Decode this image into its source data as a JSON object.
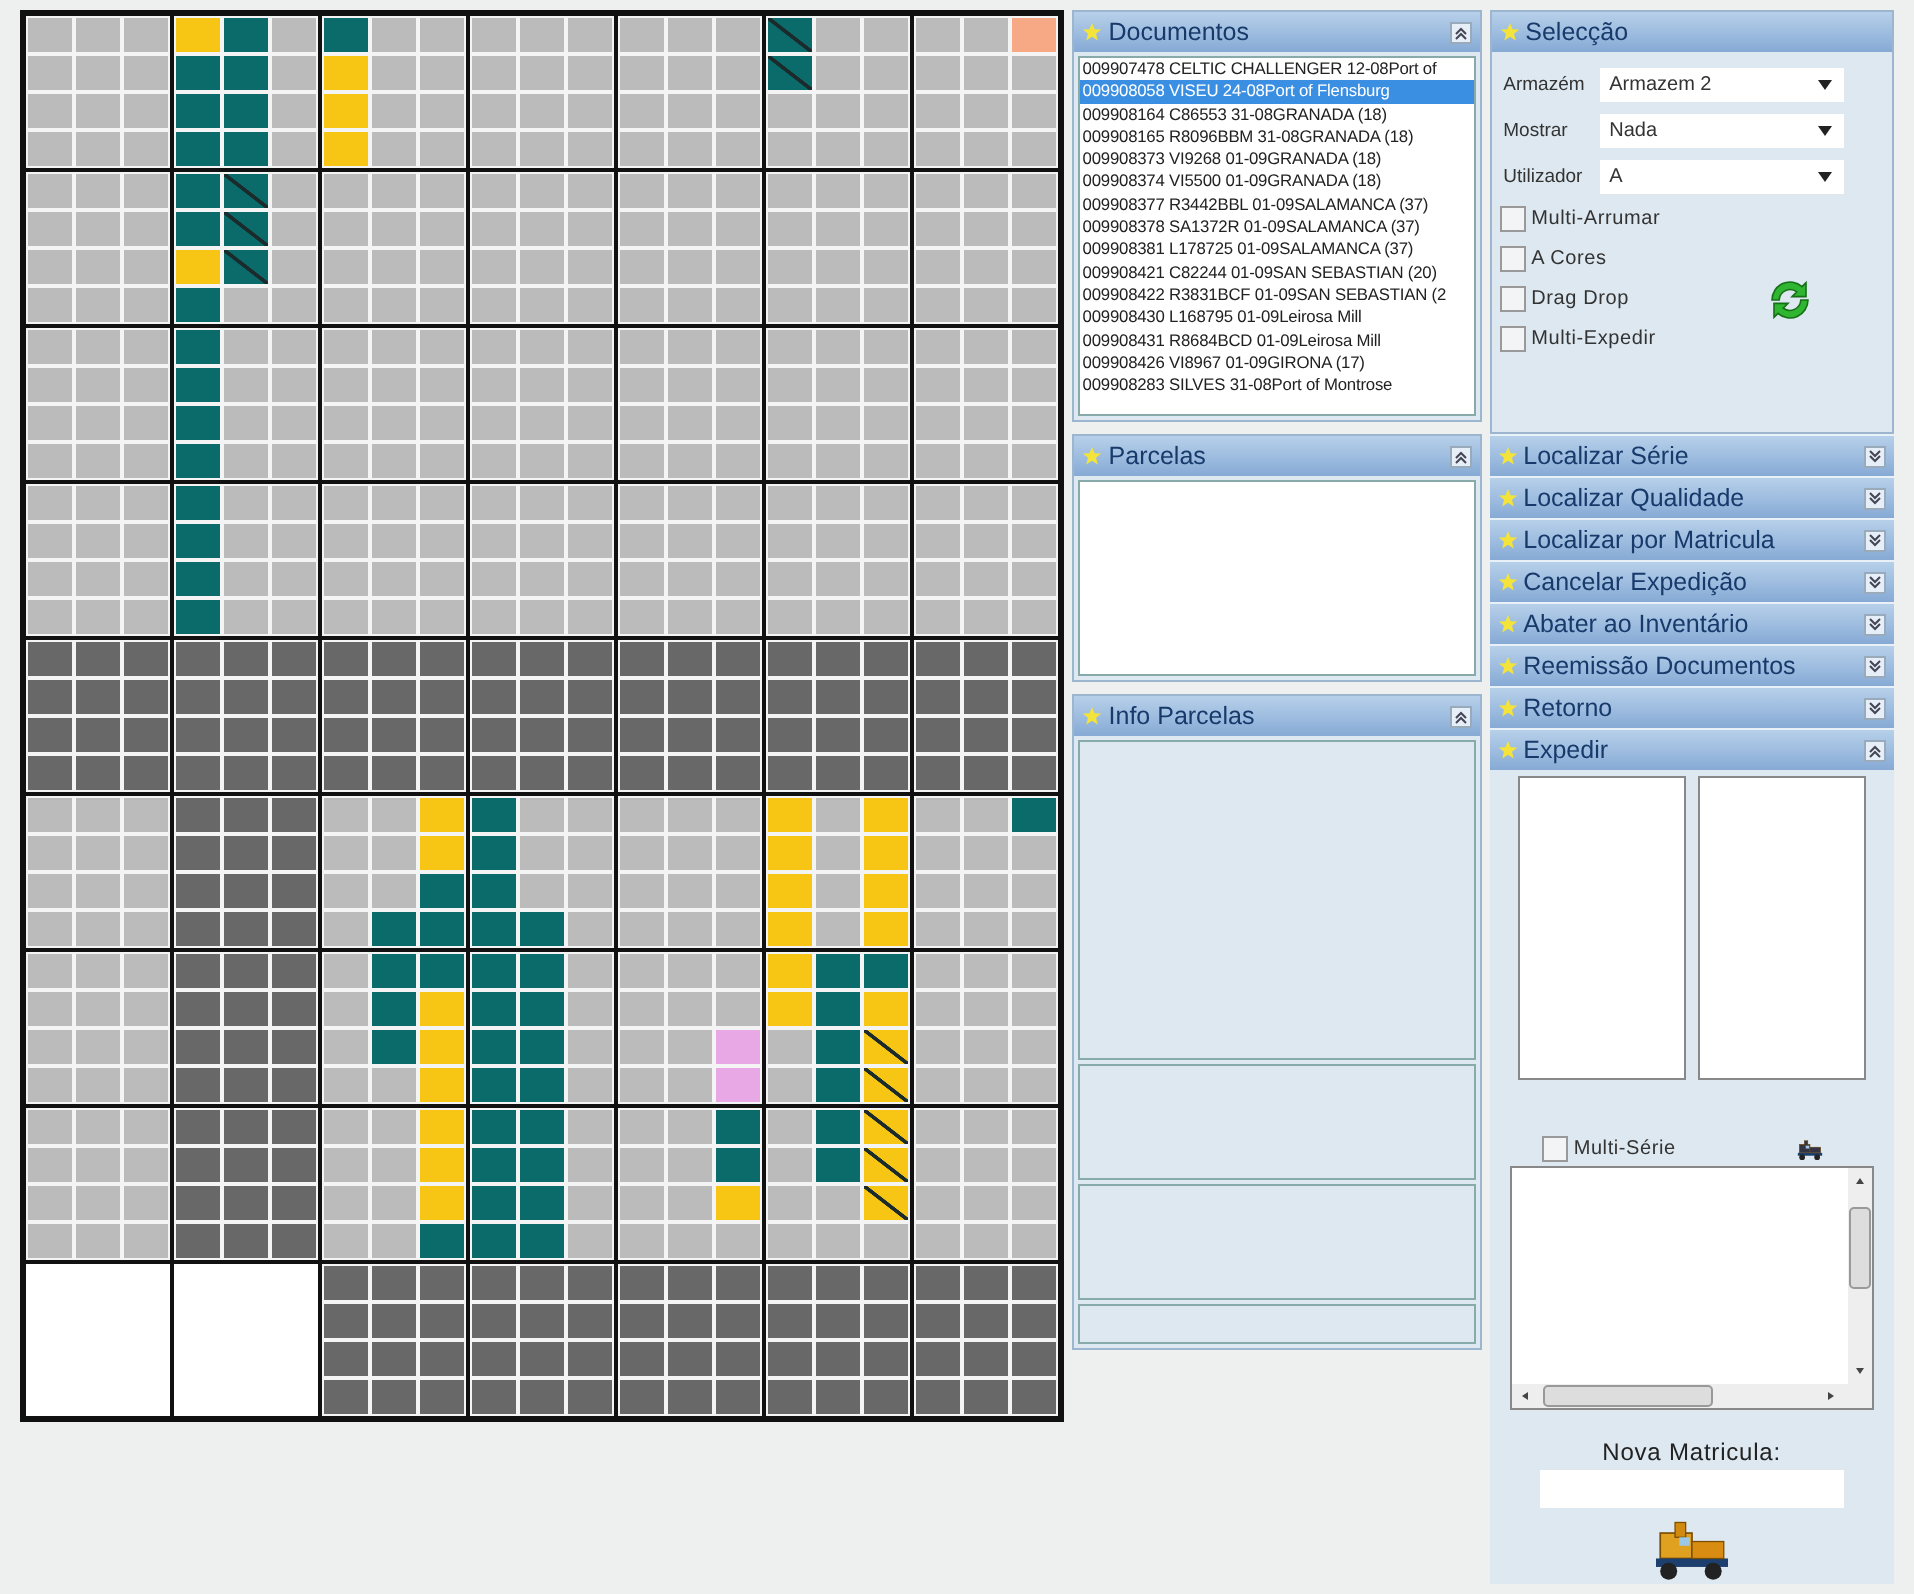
{
  "storage_map": {
    "block_rows": [
      {
        "blocks": [
          {
            "kind": "free"
          },
          {
            "kind": "mixed",
            "rows": [
              [
                {
                  "kind": "reserved"
                },
                {
                  "kind": "stock"
                },
                {
                  "kind": "free"
                }
              ],
              [
                {
                  "kind": "stock"
                },
                {
                  "kind": "stock"
                },
                {
                  "kind": "free"
                }
              ],
              [
                {
                  "kind": "stock"
                },
                {
                  "kind": "stock"
                },
                {
                  "kind": "free"
                }
              ],
              [
                {
                  "kind": "stock"
                },
                {
                  "kind": "stock"
                },
                {
                  "kind": "free"
                }
              ]
            ]
          },
          {
            "kind": "mixed",
            "rows": [
              [
                {
                  "kind": "stock"
                },
                {
                  "kind": "free"
                },
                {
                  "kind": "free"
                }
              ],
              [
                {
                  "kind": "reserved"
                },
                {
                  "kind": "free"
                },
                {
                  "kind": "free"
                }
              ],
              [
                {
                  "kind": "reserved"
                },
                {
                  "kind": "free"
                },
                {
                  "kind": "free"
                }
              ],
              [
                {
                  "kind": "reserved"
                },
                {
                  "kind": "free"
                },
                {
                  "kind": "free"
                }
              ]
            ]
          },
          {
            "kind": "free"
          },
          {
            "kind": "free"
          },
          {
            "kind": "mixed",
            "rows": [
              [
                {
                  "kind": "stockx"
                },
                {
                  "kind": "free"
                },
                {
                  "kind": "free"
                }
              ],
              [
                {
                  "kind": "stockx"
                },
                {
                  "kind": "free"
                },
                {
                  "kind": "free"
                }
              ],
              [
                {
                  "kind": "free"
                },
                {
                  "kind": "free"
                },
                {
                  "kind": "free"
                }
              ],
              [
                {
                  "kind": "free"
                },
                {
                  "kind": "free"
                },
                {
                  "kind": "free"
                }
              ]
            ]
          },
          {
            "kind": "mixed",
            "rows": [
              [
                {
                  "kind": "free"
                },
                {
                  "kind": "free"
                },
                {
                  "kind": "alert"
                }
              ],
              [
                {
                  "kind": "free"
                },
                {
                  "kind": "free"
                },
                {
                  "kind": "free"
                }
              ],
              [
                {
                  "kind": "free"
                },
                {
                  "kind": "free"
                },
                {
                  "kind": "free"
                }
              ],
              [
                {
                  "kind": "free"
                },
                {
                  "kind": "free"
                },
                {
                  "kind": "free"
                }
              ]
            ]
          }
        ]
      },
      {
        "blocks": [
          {
            "kind": "free"
          },
          {
            "kind": "mixed",
            "rows": [
              [
                {
                  "kind": "stock"
                },
                {
                  "kind": "stockx"
                },
                {
                  "kind": "free"
                }
              ],
              [
                {
                  "kind": "stock"
                },
                {
                  "kind": "stockx"
                },
                {
                  "kind": "free"
                }
              ],
              [
                {
                  "kind": "reserved"
                },
                {
                  "kind": "stockx"
                },
                {
                  "kind": "free"
                }
              ],
              [
                {
                  "kind": "stock"
                },
                {
                  "kind": "free"
                },
                {
                  "kind": "free"
                }
              ]
            ]
          },
          {
            "kind": "free"
          },
          {
            "kind": "free"
          },
          {
            "kind": "free"
          },
          {
            "kind": "free"
          },
          {
            "kind": "free"
          }
        ]
      },
      {
        "blocks": [
          {
            "kind": "free"
          },
          {
            "kind": "mixed",
            "rows": [
              [
                {
                  "kind": "stock"
                },
                {
                  "kind": "free"
                },
                {
                  "kind": "free"
                }
              ],
              [
                {
                  "kind": "stock"
                },
                {
                  "kind": "free"
                },
                {
                  "kind": "free"
                }
              ],
              [
                {
                  "kind": "stock"
                },
                {
                  "kind": "free"
                },
                {
                  "kind": "free"
                }
              ],
              [
                {
                  "kind": "stock"
                },
                {
                  "kind": "free"
                },
                {
                  "kind": "free"
                }
              ]
            ]
          },
          {
            "kind": "free"
          },
          {
            "kind": "free"
          },
          {
            "kind": "free"
          },
          {
            "kind": "free"
          },
          {
            "kind": "free"
          }
        ]
      },
      {
        "blocks": [
          {
            "kind": "free"
          },
          {
            "kind": "mixed",
            "rows": [
              [
                {
                  "kind": "stock"
                },
                {
                  "kind": "free"
                },
                {
                  "kind": "free"
                }
              ],
              [
                {
                  "kind": "stock"
                },
                {
                  "kind": "free"
                },
                {
                  "kind": "free"
                }
              ],
              [
                {
                  "kind": "stock"
                },
                {
                  "kind": "free"
                },
                {
                  "kind": "free"
                }
              ],
              [
                {
                  "kind": "stock"
                },
                {
                  "kind": "free"
                },
                {
                  "kind": "free"
                }
              ]
            ]
          },
          {
            "kind": "free"
          },
          {
            "kind": "free"
          },
          {
            "kind": "free"
          },
          {
            "kind": "free"
          },
          {
            "kind": "free"
          }
        ]
      },
      {
        "blocks": [
          {
            "kind": "blocked"
          },
          {
            "kind": "blocked"
          },
          {
            "kind": "blocked"
          },
          {
            "kind": "blocked"
          },
          {
            "kind": "blocked"
          },
          {
            "kind": "blocked"
          },
          {
            "kind": "blocked"
          }
        ]
      },
      {
        "blocks": [
          {
            "kind": "free"
          },
          {
            "kind": "blocked"
          },
          {
            "kind": "mixed",
            "rows": [
              [
                {
                  "kind": "free"
                },
                {
                  "kind": "free"
                },
                {
                  "kind": "reserved"
                }
              ],
              [
                {
                  "kind": "free"
                },
                {
                  "kind": "free"
                },
                {
                  "kind": "reserved"
                }
              ],
              [
                {
                  "kind": "free"
                },
                {
                  "kind": "free"
                },
                {
                  "kind": "stock"
                }
              ],
              [
                {
                  "kind": "free"
                },
                {
                  "kind": "stock"
                },
                {
                  "kind": "stock"
                }
              ]
            ]
          },
          {
            "kind": "mixed",
            "rows": [
              [
                {
                  "kind": "stock"
                },
                {
                  "kind": "free"
                },
                {
                  "kind": "free"
                }
              ],
              [
                {
                  "kind": "stock"
                },
                {
                  "kind": "free"
                },
                {
                  "kind": "free"
                }
              ],
              [
                {
                  "kind": "stock"
                },
                {
                  "kind": "free"
                },
                {
                  "kind": "free"
                }
              ],
              [
                {
                  "kind": "stock"
                },
                {
                  "kind": "stock"
                },
                {
                  "kind": "free"
                }
              ]
            ]
          },
          {
            "kind": "free"
          },
          {
            "kind": "mixed",
            "rows": [
              [
                {
                  "kind": "reserved"
                },
                {
                  "kind": "free"
                },
                {
                  "kind": "reserved"
                }
              ],
              [
                {
                  "kind": "reserved"
                },
                {
                  "kind": "free"
                },
                {
                  "kind": "reserved"
                }
              ],
              [
                {
                  "kind": "reserved"
                },
                {
                  "kind": "free"
                },
                {
                  "kind": "reserved"
                }
              ],
              [
                {
                  "kind": "reserved"
                },
                {
                  "kind": "free"
                },
                {
                  "kind": "reserved"
                }
              ]
            ]
          },
          {
            "kind": "mixed",
            "rows": [
              [
                {
                  "kind": "free"
                },
                {
                  "kind": "free"
                },
                {
                  "kind": "stock"
                }
              ],
              [
                {
                  "kind": "free"
                },
                {
                  "kind": "free"
                },
                {
                  "kind": "free"
                }
              ],
              [
                {
                  "kind": "free"
                },
                {
                  "kind": "free"
                },
                {
                  "kind": "free"
                }
              ],
              [
                {
                  "kind": "free"
                },
                {
                  "kind": "free"
                },
                {
                  "kind": "free"
                }
              ]
            ]
          }
        ]
      },
      {
        "blocks": [
          {
            "kind": "free"
          },
          {
            "kind": "blocked"
          },
          {
            "kind": "mixed",
            "rows": [
              [
                {
                  "kind": "free"
                },
                {
                  "kind": "stock"
                },
                {
                  "kind": "stock"
                }
              ],
              [
                {
                  "kind": "free"
                },
                {
                  "kind": "stock"
                },
                {
                  "kind": "reserved"
                }
              ],
              [
                {
                  "kind": "free"
                },
                {
                  "kind": "stock"
                },
                {
                  "kind": "reserved"
                }
              ],
              [
                {
                  "kind": "free"
                },
                {
                  "kind": "free"
                },
                {
                  "kind": "reserved"
                }
              ]
            ]
          },
          {
            "kind": "mixed",
            "rows": [
              [
                {
                  "kind": "stock"
                },
                {
                  "kind": "stock"
                },
                {
                  "kind": "free"
                }
              ],
              [
                {
                  "kind": "stock"
                },
                {
                  "kind": "stock"
                },
                {
                  "kind": "free"
                }
              ],
              [
                {
                  "kind": "stock"
                },
                {
                  "kind": "stock"
                },
                {
                  "kind": "free"
                }
              ],
              [
                {
                  "kind": "stock"
                },
                {
                  "kind": "stock"
                },
                {
                  "kind": "free"
                }
              ]
            ]
          },
          {
            "kind": "mixed",
            "rows": [
              [
                {
                  "kind": "free"
                },
                {
                  "kind": "free"
                },
                {
                  "kind": "free"
                }
              ],
              [
                {
                  "kind": "free"
                },
                {
                  "kind": "free"
                },
                {
                  "kind": "free"
                }
              ],
              [
                {
                  "kind": "free"
                },
                {
                  "kind": "free"
                },
                {
                  "kind": "held"
                }
              ],
              [
                {
                  "kind": "free"
                },
                {
                  "kind": "free"
                },
                {
                  "kind": "held"
                }
              ]
            ]
          },
          {
            "kind": "mixed",
            "rows": [
              [
                {
                  "kind": "reserved"
                },
                {
                  "kind": "stock"
                },
                {
                  "kind": "stock"
                }
              ],
              [
                {
                  "kind": "reserved"
                },
                {
                  "kind": "stock"
                },
                {
                  "kind": "reserved"
                }
              ],
              [
                {
                  "kind": "free"
                },
                {
                  "kind": "stock"
                },
                {
                  "kind": "reservedx"
                }
              ],
              [
                {
                  "kind": "free"
                },
                {
                  "kind": "stock"
                },
                {
                  "kind": "reservedx"
                }
              ]
            ]
          },
          {
            "kind": "free"
          }
        ]
      },
      {
        "blocks": [
          {
            "kind": "free"
          },
          {
            "kind": "blocked"
          },
          {
            "kind": "mixed",
            "rows": [
              [
                {
                  "kind": "free"
                },
                {
                  "kind": "free"
                },
                {
                  "kind": "reserved"
                }
              ],
              [
                {
                  "kind": "free"
                },
                {
                  "kind": "free"
                },
                {
                  "kind": "reserved"
                }
              ],
              [
                {
                  "kind": "free"
                },
                {
                  "kind": "free"
                },
                {
                  "kind": "reserved"
                }
              ],
              [
                {
                  "kind": "free"
                },
                {
                  "kind": "free"
                },
                {
                  "kind": "stock"
                }
              ]
            ]
          },
          {
            "kind": "mixed",
            "rows": [
              [
                {
                  "kind": "stock"
                },
                {
                  "kind": "stock"
                },
                {
                  "kind": "free"
                }
              ],
              [
                {
                  "kind": "stock"
                },
                {
                  "kind": "stock"
                },
                {
                  "kind": "free"
                }
              ],
              [
                {
                  "kind": "stock"
                },
                {
                  "kind": "stock"
                },
                {
                  "kind": "free"
                }
              ],
              [
                {
                  "kind": "stock"
                },
                {
                  "kind": "stock"
                },
                {
                  "kind": "free"
                }
              ]
            ]
          },
          {
            "kind": "mixed",
            "rows": [
              [
                {
                  "kind": "free"
                },
                {
                  "kind": "free"
                },
                {
                  "kind": "stock"
                }
              ],
              [
                {
                  "kind": "free"
                },
                {
                  "kind": "free"
                },
                {
                  "kind": "stock"
                }
              ],
              [
                {
                  "kind": "free"
                },
                {
                  "kind": "free"
                },
                {
                  "kind": "reserved"
                }
              ],
              [
                {
                  "kind": "free"
                },
                {
                  "kind": "free"
                },
                {
                  "kind": "free"
                }
              ]
            ]
          },
          {
            "kind": "mixed",
            "rows": [
              [
                {
                  "kind": "free"
                },
                {
                  "kind": "stock"
                },
                {
                  "kind": "reservedx"
                }
              ],
              [
                {
                  "kind": "free"
                },
                {
                  "kind": "stock"
                },
                {
                  "kind": "reservedx"
                }
              ],
              [
                {
                  "kind": "free"
                },
                {
                  "kind": "free"
                },
                {
                  "kind": "reservedx"
                }
              ],
              [
                {
                  "kind": "free"
                },
                {
                  "kind": "free"
                },
                {
                  "kind": "free"
                }
              ]
            ]
          },
          {
            "kind": "free"
          }
        ]
      },
      {
        "blocks": [
          {
            "kind": "void"
          },
          {
            "kind": "void"
          },
          {
            "kind": "blocked"
          },
          {
            "kind": "blocked"
          },
          {
            "kind": "blocked"
          },
          {
            "kind": "blocked"
          },
          {
            "kind": "blocked"
          }
        ]
      }
    ]
  },
  "documentos": {
    "title": "Documentos",
    "expanded": true,
    "items": [
      {
        "text": "009907478 CELTIC CHALLENGER 12-08Port of",
        "selected": false
      },
      {
        "text": "009908058 VISEU 24-08Port of Flensburg",
        "selected": true
      },
      {
        "text": "009908164 C86553 31-08GRANADA (18)",
        "selected": false
      },
      {
        "text": "009908165 R8096BBM 31-08GRANADA (18)",
        "selected": false
      },
      {
        "text": "009908373 VI9268 01-09GRANADA (18)",
        "selected": false
      },
      {
        "text": "009908374 VI5500 01-09GRANADA (18)",
        "selected": false
      },
      {
        "text": "009908377 R3442BBL 01-09SALAMANCA (37)",
        "selected": false
      },
      {
        "text": "009908378 SA1372R 01-09SALAMANCA (37)",
        "selected": false
      },
      {
        "text": "009908381 L178725 01-09SALAMANCA (37)",
        "selected": false
      },
      {
        "text": "009908421 C82244 01-09SAN SEBASTIAN (20)",
        "selected": false
      },
      {
        "text": "009908422 R3831BCF 01-09SAN SEBASTIAN (2",
        "selected": false
      },
      {
        "text": "009908430 L168795 01-09Leirosa Mill",
        "selected": false
      },
      {
        "text": "009908431 R8684BCD 01-09Leirosa Mill",
        "selected": false
      },
      {
        "text": "009908426 VI8967 01-09GIRONA (17)",
        "selected": false
      },
      {
        "text": "009908283 SILVES 31-08Port of Montrose",
        "selected": false
      }
    ]
  },
  "parcelas": {
    "title": "Parcelas",
    "expanded": true
  },
  "info_parcelas": {
    "title": "Info Parcelas",
    "expanded": true
  },
  "seleccao": {
    "title": "Selecção",
    "fields": [
      {
        "label": "Armazém",
        "value": "Armazem 2"
      },
      {
        "label": "Mostrar",
        "value": "Nada"
      },
      {
        "label": "Utilizador",
        "value": "A"
      }
    ],
    "checkboxes": [
      {
        "label": "Multi-Arrumar",
        "checked": false
      },
      {
        "label": "A Cores",
        "checked": false
      },
      {
        "label": "Drag Drop",
        "checked": false
      },
      {
        "label": "Multi-Expedir",
        "checked": false
      }
    ]
  },
  "sections": [
    {
      "title": "Localizar Série",
      "expanded": false
    },
    {
      "title": "Localizar Qualidade",
      "expanded": false
    },
    {
      "title": "Localizar por Matricula",
      "expanded": false
    },
    {
      "title": "Cancelar Expedição",
      "expanded": false
    },
    {
      "title": "Abater ao Inventário",
      "expanded": false
    },
    {
      "title": "Reemissão Documentos",
      "expanded": false
    },
    {
      "title": "Retorno",
      "expanded": false
    },
    {
      "title": "Expedir",
      "expanded": true
    }
  ],
  "expedir": {
    "multi_serie": {
      "label": "Multi-Série",
      "checked": false
    },
    "nova_matricula": {
      "label": "Nova Matricula:"
    }
  }
}
